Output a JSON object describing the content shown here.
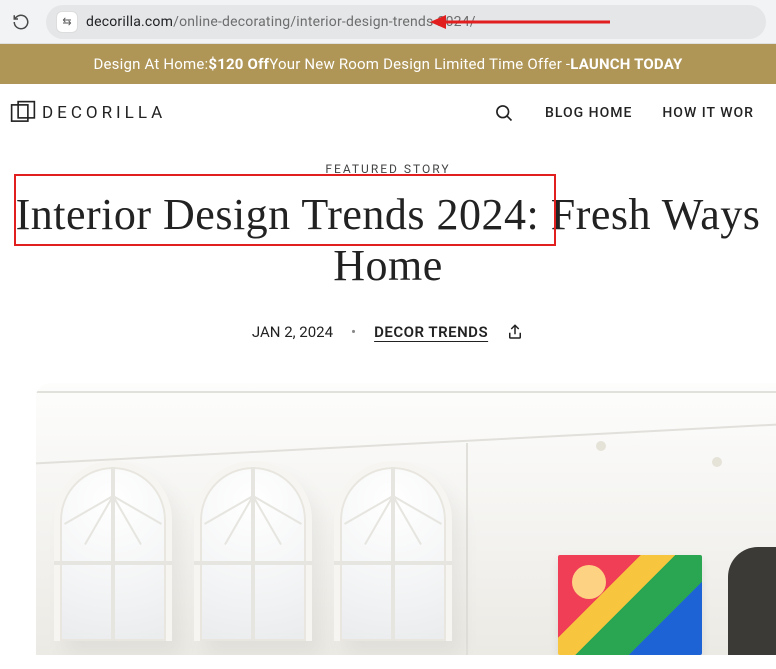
{
  "browser": {
    "url_domain": "decorilla.com",
    "url_path": "/online-decorating/interior-design-trends-2024/",
    "site_info_glyph": "⇆"
  },
  "annotation": {
    "arrow_color": "#e21f1f"
  },
  "promo": {
    "prefix": "Design At Home: ",
    "offer": "$120 Off",
    "middle": " Your New Room Design Limited Time Offer - ",
    "cta": "LAUNCH TODAY"
  },
  "header": {
    "brand": "DECORILLA",
    "nav": {
      "blog_home": "BLOG HOME",
      "how_it_works": "HOW IT WOR"
    }
  },
  "article": {
    "featured_label": "FEATURED STORY",
    "title_line1": "Interior Design Trends 2024: Fresh Ways",
    "title_line2": "Home",
    "date": "JAN 2, 2024",
    "dot": "•",
    "category": "DECOR TRENDS"
  }
}
